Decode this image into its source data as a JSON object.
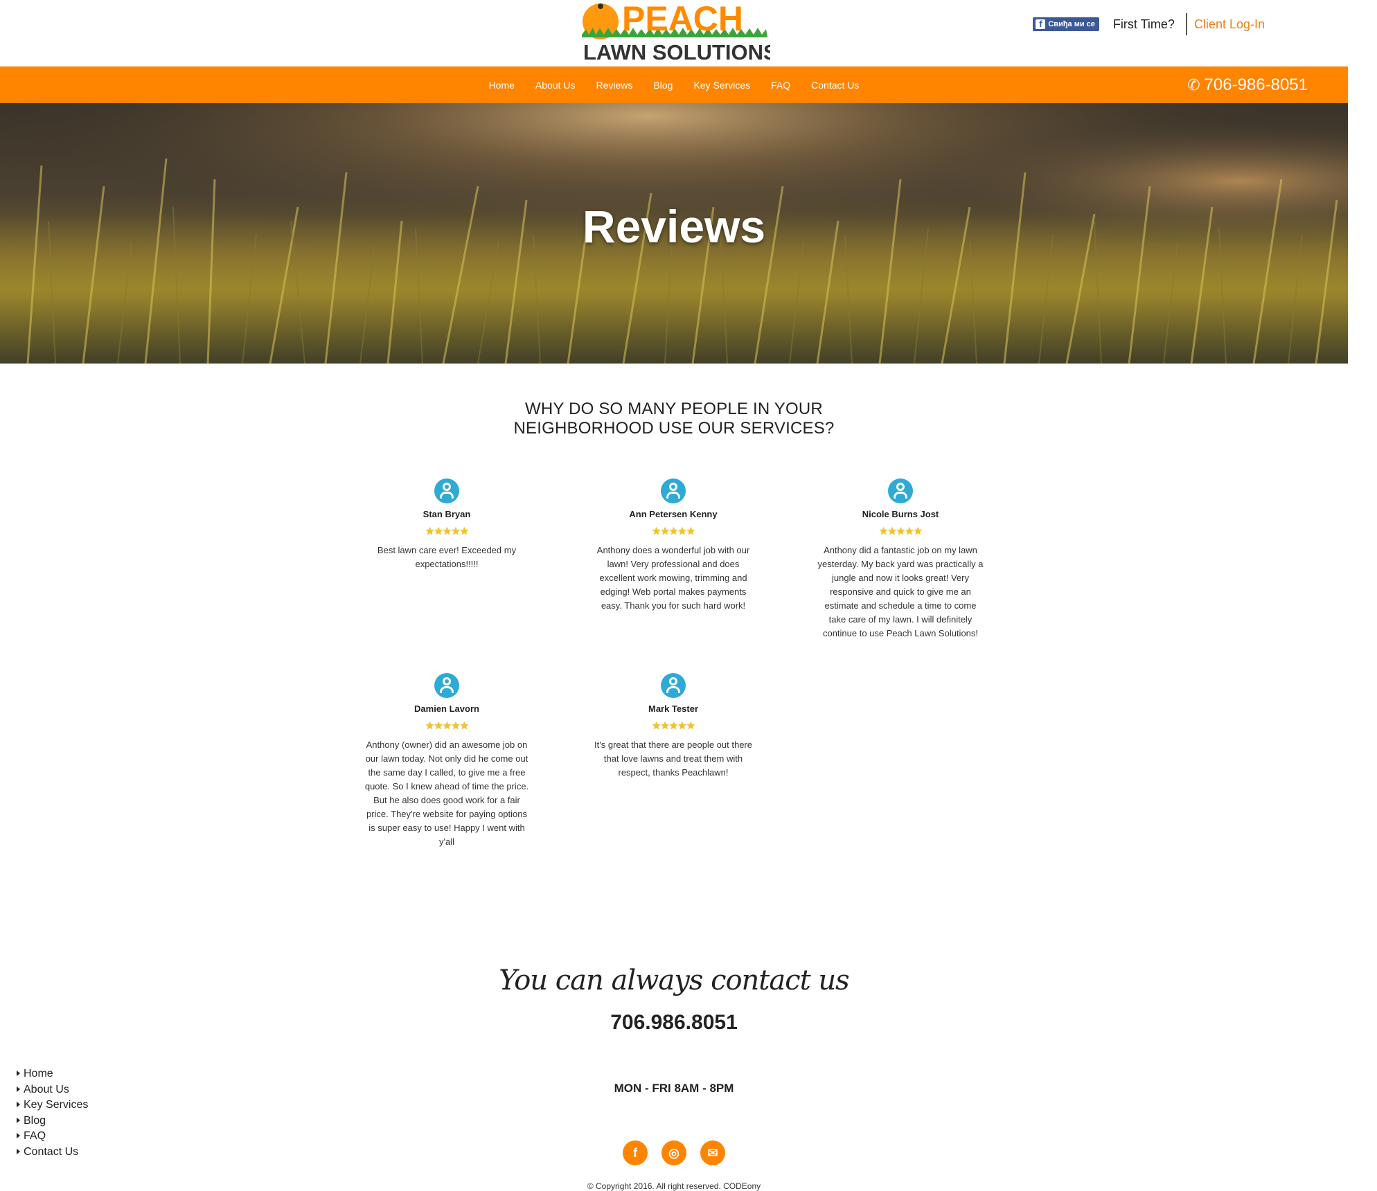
{
  "header": {
    "logo": {
      "line1": "PEACH",
      "line2": "LAWN SOLUTIONS"
    },
    "fb_like": "Свиђа ми се",
    "first_time": "First Time?",
    "client_login": "Client Log-In"
  },
  "nav": {
    "items": [
      "Home",
      "About Us",
      "Reviews",
      "Blog",
      "Key Services",
      "FAQ",
      "Contact Us"
    ],
    "phone": "706-986-8051"
  },
  "hero": {
    "title": "Reviews"
  },
  "reviews_section": {
    "heading_line1": "WHY DO SO MANY PEOPLE IN YOUR",
    "heading_line2": "NEIGHBORHOOD USE OUR SERVICES?",
    "reviews": [
      {
        "name": "Stan Bryan",
        "stars": "★★★★★",
        "rating": 5,
        "text": "Best lawn care ever! Exceeded my expectations!!!!!"
      },
      {
        "name": "Ann Petersen Kenny",
        "stars": "★★★★★",
        "rating": 5,
        "text": "Anthony does a wonderful job with our lawn! Very professional and does excellent work mowing, trimming and edging! Web portal makes payments easy. Thank you for such hard work!"
      },
      {
        "name": "Nicole Burns Jost",
        "stars": "★★★★★",
        "rating": 5,
        "text": "Anthony did a fantastic job on my lawn yesterday. My back yard was practically a jungle and now it looks great! Very responsive and quick to give me an estimate and schedule a time to come take care of my lawn. I will definitely continue to use Peach Lawn Solutions!"
      },
      {
        "name": "Damien Lavorn",
        "stars": "★★★★★",
        "rating": 5,
        "text": "Anthony (owner) did an awesome job on our lawn today. Not only did he come out the same day I called, to give me a free quote. So I knew ahead of time the price. But he also does good work for a fair price. They're website for paying options is super easy to use! Happy I went with y'all"
      },
      {
        "name": "Mark Tester",
        "stars": "★★★★★",
        "rating": 5,
        "text": "It's great that there are people out there that love lawns and treat them with respect, thanks Peachlawn!"
      }
    ]
  },
  "contact": {
    "title": "You can always contact us",
    "phone": "706.986.8051",
    "hours": "MON - FRI 8AM - 8PM"
  },
  "footer": {
    "links": [
      "Home",
      "About Us",
      "Key Services",
      "Blog",
      "FAQ",
      "Contact Us"
    ],
    "socials": [
      {
        "icon": "facebook-icon",
        "glyph": "f"
      },
      {
        "icon": "instagram-icon",
        "glyph": "◎"
      },
      {
        "icon": "mail-icon",
        "glyph": "✉"
      }
    ],
    "copyright": "© Copyright 2016. All right reserved. CODEony"
  },
  "colors": {
    "accent": "#ff8400",
    "avatar": "#2eaad6",
    "star": "#f5c518",
    "login": "#e8801a"
  }
}
